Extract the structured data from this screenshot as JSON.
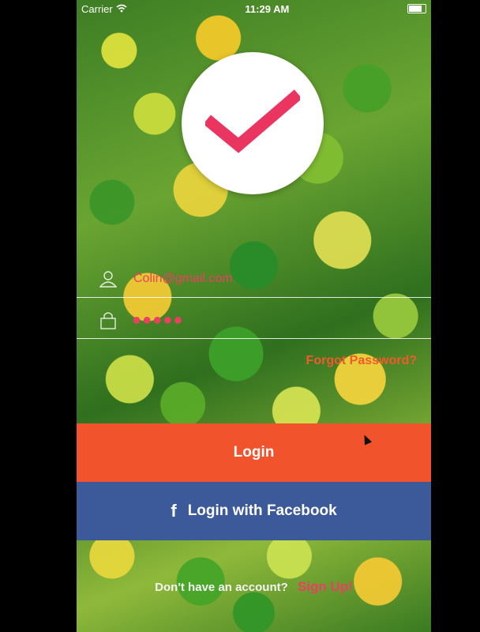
{
  "status_bar": {
    "carrier": "Carrier",
    "time": "11:29 AM"
  },
  "login_form": {
    "email_value": "Colin@gmail.com",
    "password_dots": "●●●●●",
    "forgot_password": "Forgot Password?"
  },
  "buttons": {
    "login_label": "Login",
    "facebook_label": "Login with Facebook",
    "facebook_glyph": "f"
  },
  "footer": {
    "prompt": "Don't have an account?",
    "signup_label": "Sign Up!"
  },
  "colors": {
    "accent_pink": "#ec3f62",
    "login_orange": "#f1542d",
    "facebook_blue": "#3c5a9a",
    "forgot_orange": "#f25a2b"
  },
  "icons": {
    "logo": "checkmark-icon",
    "email": "user-icon",
    "password": "lock-icon",
    "wifi": "wifi-icon",
    "battery": "battery-icon",
    "facebook": "facebook-icon"
  }
}
